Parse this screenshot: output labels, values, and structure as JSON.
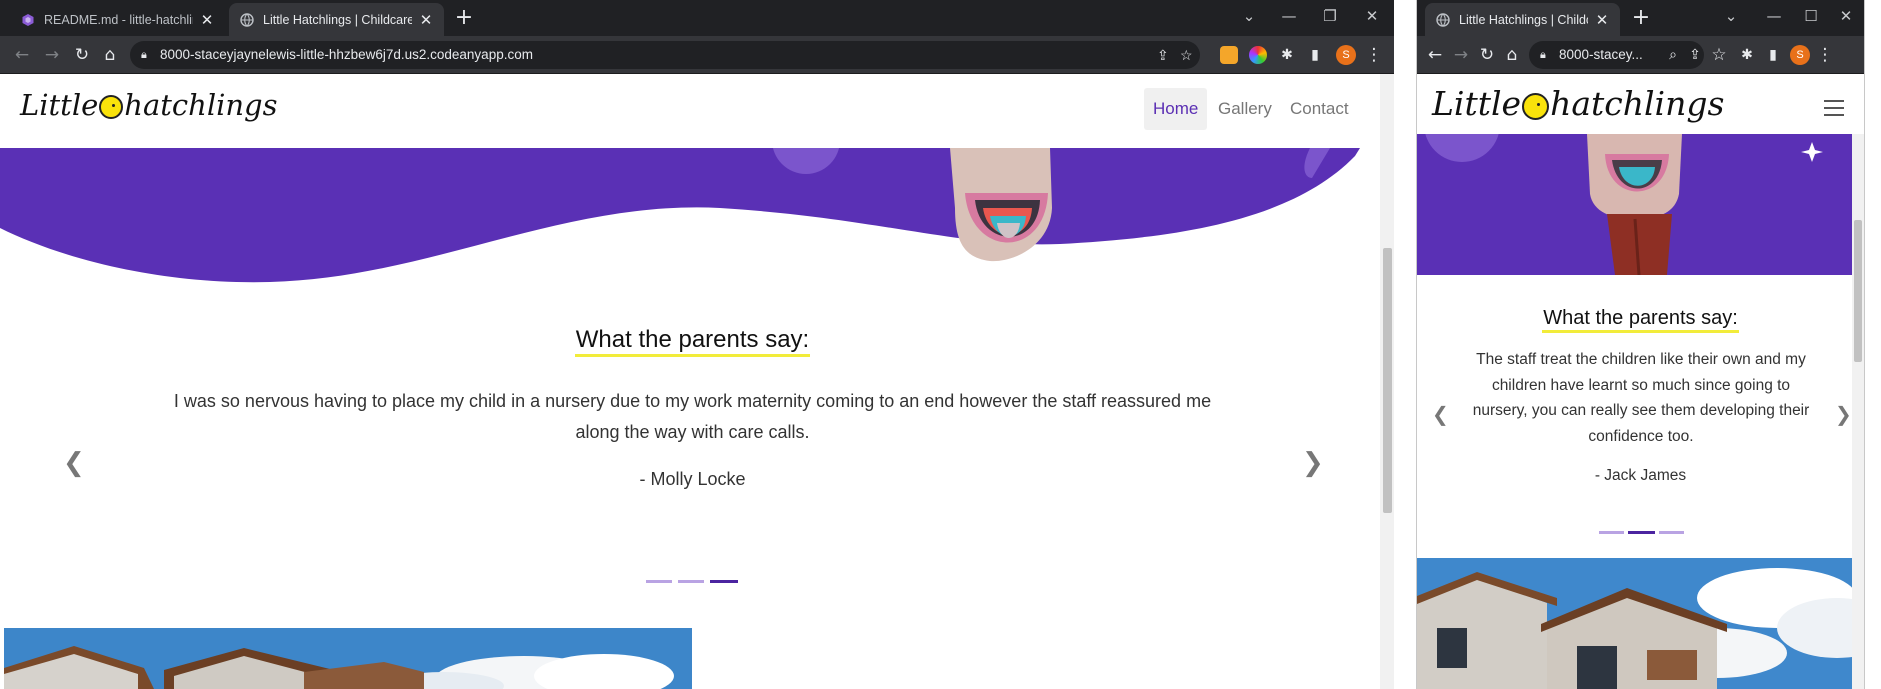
{
  "left_window": {
    "tabs": [
      {
        "title": "README.md - little-hatchlings - G",
        "icon": "gitpod-icon"
      },
      {
        "title": "Little Hatchlings | Childcare Nurs",
        "icon": "globe-icon"
      }
    ],
    "url": "8000-staceyjaynelewis-little-hhzbew6j7d.us2.codeanyapp.com",
    "profile_initial": "S"
  },
  "right_window": {
    "tabs": [
      {
        "title": "Little Hatchlings | Childcare Nu",
        "icon": "globe-icon"
      }
    ],
    "url": "8000-stacey...",
    "profile_initial": "S"
  },
  "site": {
    "logo_left": "Little",
    "logo_right": "hatchlings",
    "nav": [
      "Home",
      "Gallery",
      "Contact"
    ],
    "active_nav": "Home",
    "colors": {
      "accent": "#5b2fb3",
      "hero_purple": "#5a30b5",
      "underline": "#f2ec3a",
      "indicator_active": "#4b24a0",
      "indicator_inactive": "#b9a3e3"
    }
  },
  "testimonial_left": {
    "title": "What the parents say:",
    "quote": "I was so nervous having to place my child in a nursery due to my work maternity coming to an end however the staff reassured me along the way with care calls.",
    "author": "- Molly Locke",
    "indicators": 3,
    "active_indicator": 3
  },
  "testimonial_right": {
    "title": "What the parents say:",
    "quote": "The staff treat the children like their own and my children have learnt so much since going to nursery, you can really see them developing their confidence too.",
    "author": "- Jack James",
    "indicators": 3,
    "active_indicator": 2
  }
}
